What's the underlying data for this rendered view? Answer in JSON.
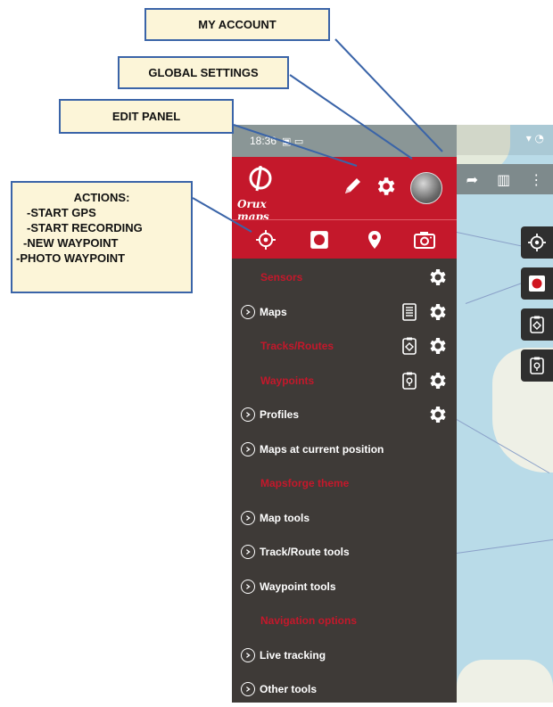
{
  "callouts": {
    "my_account": "MY ACCOUNT",
    "global_settings": "GLOBAL SETTINGS",
    "edit_panel": "EDIT PANEL",
    "actions": [
      "ACTIONS:",
      "-START GPS",
      "-START RECORDING",
      "-NEW WAYPOINT",
      "-PHOTO WAYPOINT"
    ]
  },
  "status_bar": {
    "time": "18:36",
    "icons": "▣ ▭"
  },
  "header": {
    "logo_text": "Orux maps",
    "logo_mark": "O"
  },
  "menu": {
    "items": [
      {
        "label": "Sensors",
        "kind": "section",
        "gear": true
      },
      {
        "label": "Maps",
        "kind": "expandable",
        "gear": true,
        "doc": "list-document-icon"
      },
      {
        "label": "Tracks/Routes",
        "kind": "section",
        "gear": true,
        "doc": "track-document-icon"
      },
      {
        "label": "Waypoints",
        "kind": "section",
        "gear": true,
        "doc": "waypoint-document-icon"
      },
      {
        "label": "Profiles",
        "kind": "expandable",
        "gear": true
      },
      {
        "label": "Maps at current position",
        "kind": "expandable"
      },
      {
        "label": "Mapsforge theme",
        "kind": "section"
      },
      {
        "label": "Map tools",
        "kind": "expandable"
      },
      {
        "label": "Track/Route tools",
        "kind": "expandable"
      },
      {
        "label": "Waypoint tools",
        "kind": "expandable"
      },
      {
        "label": "Navigation options",
        "kind": "section"
      },
      {
        "label": "Live tracking",
        "kind": "expandable"
      },
      {
        "label": "Other tools",
        "kind": "expandable"
      }
    ]
  },
  "colors": {
    "accent": "#c4182b",
    "drawer_bg": "#3e3a37",
    "callout_bg": "#fcf5d8",
    "callout_border": "#3a64a8"
  }
}
